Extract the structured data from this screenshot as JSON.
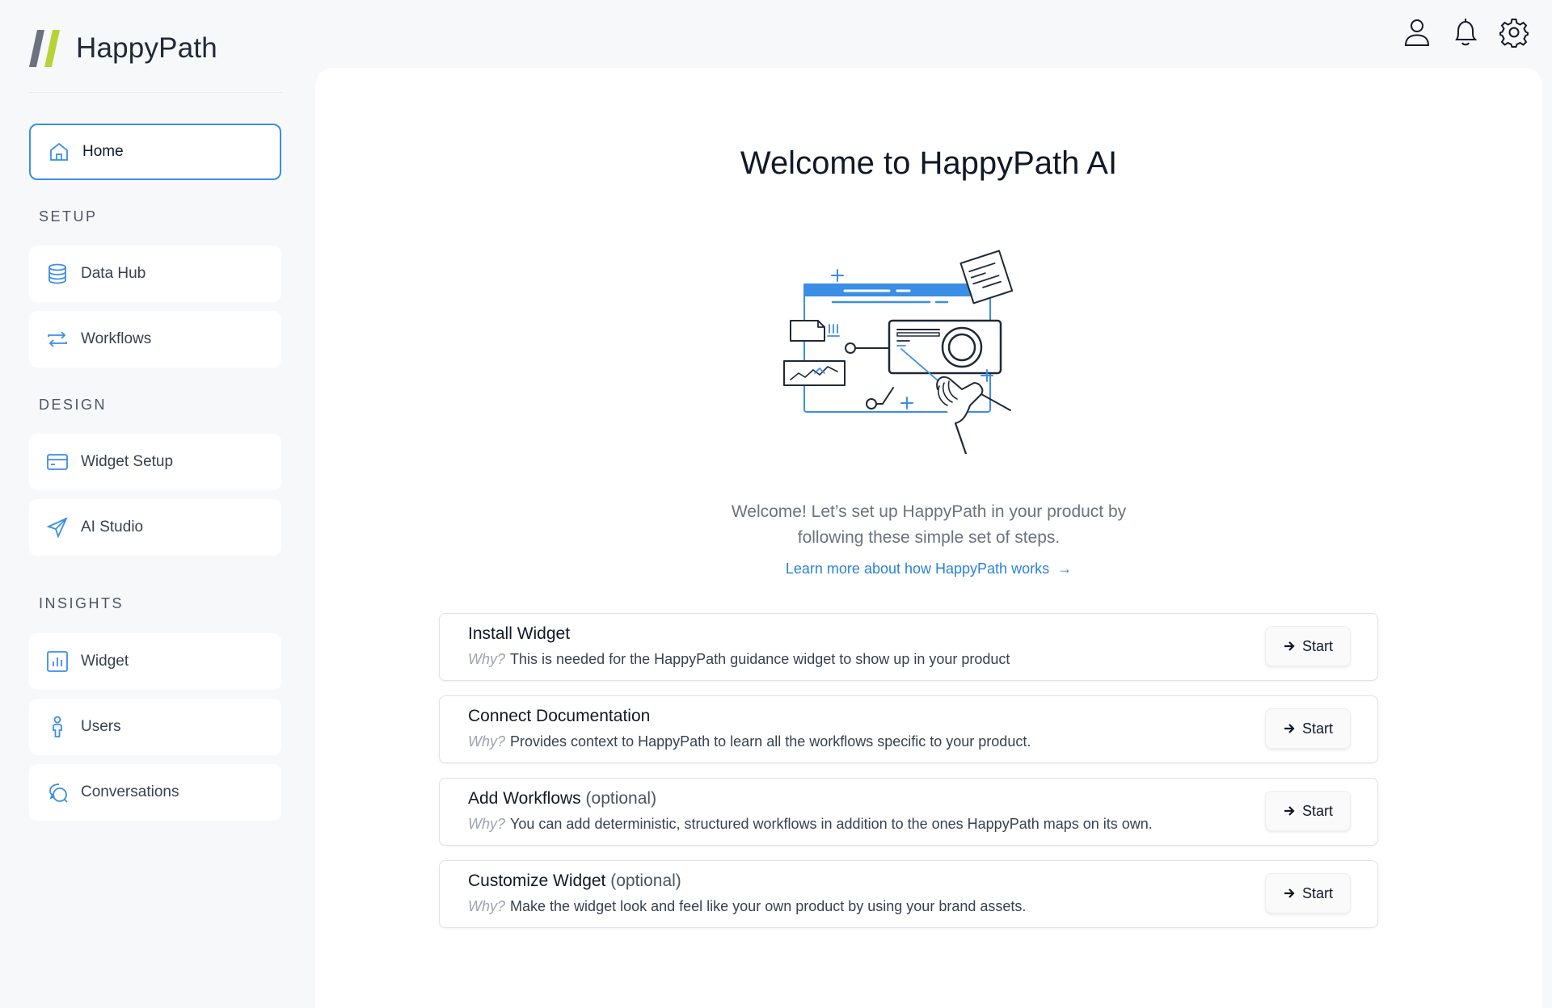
{
  "brand": {
    "name": "HappyPath",
    "colors": {
      "slash_dark": "#6b7280",
      "slash_green": "#b8d335",
      "accent": "#3b8ee3"
    }
  },
  "sidebar": {
    "home": {
      "label": "Home",
      "icon": "home-icon"
    },
    "sections": [
      {
        "label": "SETUP",
        "items": [
          {
            "label": "Data Hub",
            "icon": "database-icon"
          },
          {
            "label": "Workflows",
            "icon": "repeat-arrows-icon"
          }
        ]
      },
      {
        "label": "DESIGN",
        "items": [
          {
            "label": "Widget Setup",
            "icon": "card-icon"
          },
          {
            "label": "AI Studio",
            "icon": "send-icon"
          }
        ]
      },
      {
        "label": "INSIGHTS",
        "items": [
          {
            "label": "Widget",
            "icon": "bar-chart-icon"
          },
          {
            "label": "Users",
            "icon": "person-icon"
          },
          {
            "label": "Conversations",
            "icon": "chat-bubbles-icon"
          }
        ]
      }
    ]
  },
  "header": {
    "icons": [
      "user-icon",
      "bell-icon",
      "gear-icon"
    ]
  },
  "main": {
    "title": "Welcome to HappyPath AI",
    "intro_line1": "Welcome! Let’s set up HappyPath in your product by",
    "intro_line2": "following these simple set of steps.",
    "learn_more": "Learn more about how HappyPath works",
    "why_label": "Why?",
    "optional_label": "(optional)",
    "start_label": "Start",
    "steps": [
      {
        "title": "Install Widget",
        "optional": false,
        "desc": "This is needed for the HappyPath guidance widget to show up in your product"
      },
      {
        "title": "Connect Documentation",
        "optional": false,
        "desc": "Provides context to HappyPath to learn all the workflows specific to your product."
      },
      {
        "title": "Add Workflows",
        "optional": true,
        "desc": "You can add deterministic, structured workflows in addition to the ones HappyPath maps on its own."
      },
      {
        "title": "Customize Widget",
        "optional": true,
        "desc": "Make the widget look and feel like your own product by using your brand assets."
      }
    ]
  }
}
